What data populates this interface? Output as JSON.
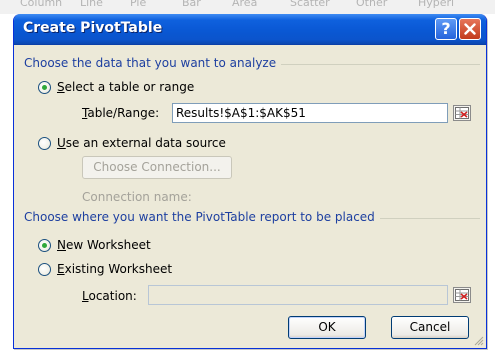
{
  "background_ribbon": {
    "items": [
      "Column",
      "Line",
      "Pie",
      "Bar",
      "Area",
      "Scatter",
      "Other",
      "Hyperl"
    ]
  },
  "dialog": {
    "title": "Create PivotTable",
    "help_label": "?",
    "close_label": "×"
  },
  "data_source": {
    "heading": "Choose the data that you want to analyze",
    "option_table_label_accel": "S",
    "option_table_label_rest": "elect a table or range",
    "option_table_checked": true,
    "range_label_accel": "T",
    "range_label_rest": "able/Range:",
    "range_value": "Results!$A$1:$AK$51",
    "option_external_label_accel": "U",
    "option_external_label_rest": "se an external data source",
    "option_external_checked": false,
    "choose_connection_label": "Choose Connection...",
    "connection_name_label": "Connection name:"
  },
  "placement": {
    "heading": "Choose where you want the PivotTable report to be placed",
    "option_new_label_accel": "N",
    "option_new_label_rest": "ew Worksheet",
    "option_new_checked": true,
    "option_existing_label_accel": "E",
    "option_existing_label_rest": "xisting Worksheet",
    "option_existing_checked": false,
    "location_label_accel": "L",
    "location_label_rest": "ocation:",
    "location_value": ""
  },
  "buttons": {
    "ok_label": "OK",
    "cancel_label": "Cancel"
  },
  "colors": {
    "title_bar": "#0a58d4",
    "group_heading": "#1d3fa0",
    "dialog_face": "#ece9d8",
    "radio_checked": "#2fa83a",
    "close_button": "#c2391b"
  }
}
